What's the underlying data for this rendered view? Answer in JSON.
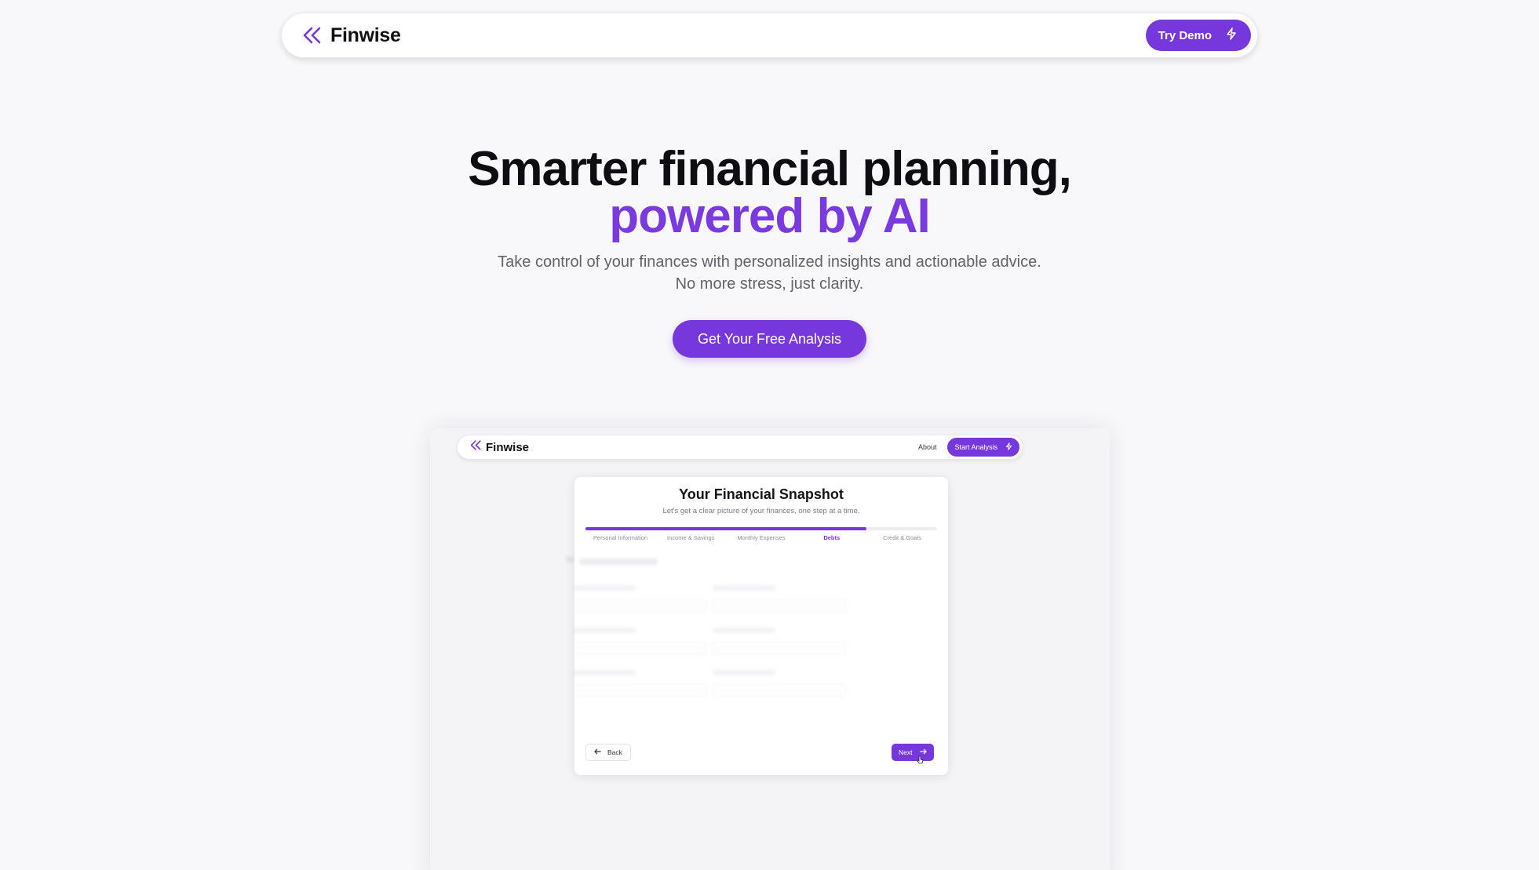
{
  "header": {
    "brand": "Finwise",
    "cta_label": "Try Demo",
    "cta_icon": "lightning-icon",
    "logo_icon": "double-chevron-left-icon"
  },
  "hero": {
    "headline_line1": "Smarter financial planning,",
    "headline_line2": "powered by AI",
    "subtext": "Take control of your finances with personalized insights and actionable advice. No more stress, just clarity.",
    "cta_label": "Get Your Free Analysis"
  },
  "preview": {
    "nav": {
      "brand": "Finwise",
      "about": "About",
      "start_label": "Start Analysis"
    },
    "card": {
      "title": "Your Financial Snapshot",
      "subtitle": "Let's get a clear picture of your finances, one step at a time.",
      "progress": 0.8,
      "steps": [
        {
          "label": "Personal Information",
          "active": false
        },
        {
          "label": "Income & Savings",
          "active": false
        },
        {
          "label": "Monthly Expenses",
          "active": false
        },
        {
          "label": "Debts",
          "active": true
        },
        {
          "label": "Credit & Goals",
          "active": false
        }
      ],
      "back_label": "Back",
      "next_label": "Next"
    }
  },
  "colors": {
    "accent": "#7637dd",
    "headline_accent": "#7a3ae0",
    "background": "#f8f8fa",
    "text": "#0e0e12",
    "muted": "#62626c"
  }
}
